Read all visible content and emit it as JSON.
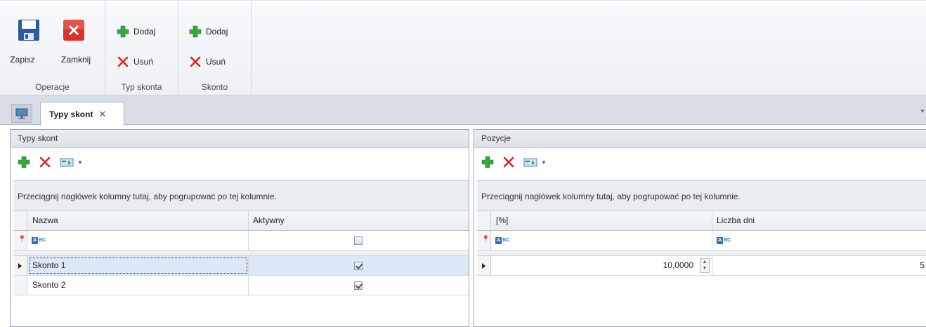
{
  "ribbon": {
    "operacje": {
      "label": "Operacje",
      "save_label": "Zapisz",
      "close_label": "Zamknij"
    },
    "typ_skonta": {
      "label": "Typ skonta",
      "add_label": "Dodaj",
      "remove_label": "Usuń"
    },
    "skonto": {
      "label": "Skonto",
      "add_label": "Dodaj",
      "remove_label": "Usuń"
    }
  },
  "tabs": {
    "active_label": "Typy skont",
    "close_symbol": "✕"
  },
  "left_panel": {
    "title": "Typy skont",
    "group_hint": "Przeciągnij nagłówek kolumny tutaj, aby pogrupować po tej kolumnie.",
    "columns": [
      "Nazwa",
      "Aktywny"
    ],
    "rows": [
      {
        "nazwa": "Skonto 1",
        "aktywny": true
      },
      {
        "nazwa": "Skonto 2",
        "aktywny": true
      }
    ]
  },
  "right_panel": {
    "title": "Pozycje",
    "group_hint": "Przeciągnij nagłówek kolumny tutaj, aby pogrupować po tej kolumnie.",
    "columns": [
      "[%]",
      "Liczba dni"
    ],
    "rows": [
      {
        "procent": "10,0000",
        "liczba_dni": "5"
      }
    ]
  },
  "colors": {
    "add_green": "#3aa53a",
    "delete_red": "#e0241b",
    "save_blue": "#2b5b9e",
    "close_red": "#d9342b"
  }
}
